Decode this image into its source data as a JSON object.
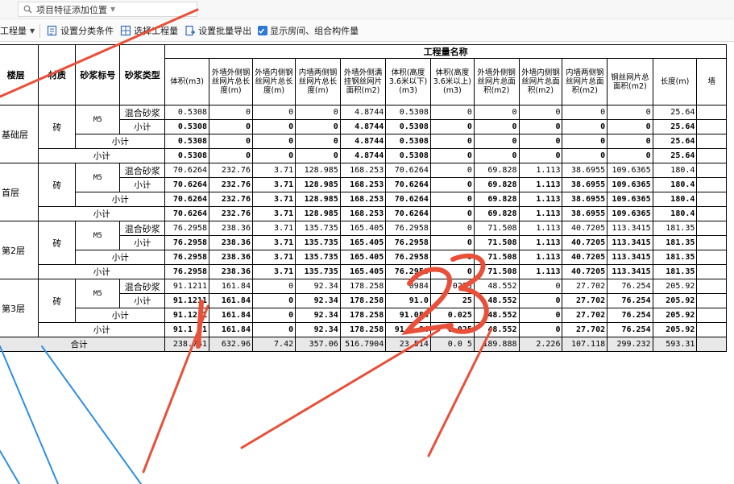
{
  "search": {
    "value": "项目特征添加位置"
  },
  "toolbar": {
    "quantity_select": "工程量",
    "set_classification": "设置分类条件",
    "select_quantity": "选择工程量",
    "batch_export": "设置批量导出",
    "show_rooms_label": "显示房间、组合构件量",
    "show_rooms_checked": true
  },
  "table": {
    "group_header": "工程量名称",
    "headers": {
      "floor": "楼层",
      "material": "材质",
      "mortar_grade": "砂浆标号",
      "mortar_type": "砂浆类型"
    },
    "columns": [
      "体积(m3)",
      "外墙外侧钢丝网片总长度(m)",
      "外墙内侧钢丝网片总长度(m)",
      "内墙两侧钢丝网片总长度(m)",
      "外墙外侧满挂钢丝网片面积(m2)",
      "体积(高度3.6米以下)(m3)",
      "体积(高度3.6米以上)(m3)",
      "外墙外侧钢丝网片总面积(m2)",
      "外墙内侧钢丝网片总面积(m2)",
      "内墙两侧钢丝网片总面积(m2)",
      "钢丝网片总面积(m2)",
      "长度(m)",
      "墙"
    ],
    "labels": {
      "subtotal": "小计",
      "total": "合计"
    },
    "floors": [
      {
        "name": "基础层",
        "material": "砖",
        "grade": "M5",
        "mortar": "混合砂浆",
        "row": [
          "0.5308",
          "0",
          "0",
          "0",
          "4.8744",
          "0.5308",
          "0",
          "0",
          "0",
          "0",
          "0",
          "25.64"
        ],
        "sub1": [
          "0.5308",
          "0",
          "0",
          "0",
          "4.8744",
          "0.5308",
          "0",
          "0",
          "0",
          "0",
          "0",
          "25.64"
        ],
        "sub2": [
          "0.5308",
          "0",
          "0",
          "0",
          "4.8744",
          "0.5308",
          "0",
          "0",
          "0",
          "0",
          "0",
          "25.64"
        ],
        "sub3": [
          "0.5308",
          "0",
          "0",
          "0",
          "4.8744",
          "0.5308",
          "0",
          "0",
          "0",
          "0",
          "0",
          "25.64"
        ]
      },
      {
        "name": "首层",
        "material": "砖",
        "grade": "M5",
        "mortar": "混合砂浆",
        "row": [
          "70.6264",
          "232.76",
          "3.71",
          "128.985",
          "168.253",
          "70.6264",
          "0",
          "69.828",
          "1.113",
          "38.6955",
          "109.6365",
          "180.4"
        ],
        "sub1": [
          "70.6264",
          "232.76",
          "3.71",
          "128.985",
          "168.253",
          "70.6264",
          "0",
          "69.828",
          "1.113",
          "38.6955",
          "109.6365",
          "180.4"
        ],
        "sub2": [
          "70.6264",
          "232.76",
          "3.71",
          "128.985",
          "168.253",
          "70.6264",
          "0",
          "69.828",
          "1.113",
          "38.6955",
          "109.6365",
          "180.4"
        ],
        "sub3": [
          "70.6264",
          "232.76",
          "3.71",
          "128.985",
          "168.253",
          "70.6264",
          "0",
          "69.828",
          "1.113",
          "38.6955",
          "109.6365",
          "180.4"
        ]
      },
      {
        "name": "第2层",
        "material": "砖",
        "grade": "M5",
        "mortar": "混合砂浆",
        "row": [
          "76.2958",
          "238.36",
          "3.71",
          "135.735",
          "165.405",
          "76.2958",
          "0",
          "71.508",
          "1.113",
          "40.7205",
          "113.3415",
          "181.35"
        ],
        "sub1": [
          "76.2958",
          "238.36",
          "3.71",
          "135.735",
          "165.405",
          "76.2958",
          "0",
          "71.508",
          "1.113",
          "40.7205",
          "113.3415",
          "181.35"
        ],
        "sub2": [
          "76.2958",
          "238.36",
          "3.71",
          "135.735",
          "165.405",
          "76.2958",
          "0",
          "71.508",
          "1.113",
          "40.7205",
          "113.3415",
          "181.35"
        ],
        "sub3": [
          "76.2958",
          "238.36",
          "3.71",
          "135.735",
          "165.405",
          "76.2958",
          "0",
          "71.508",
          "1.113",
          "40.7205",
          "113.3415",
          "181.35"
        ]
      },
      {
        "name": "第3层",
        "material": "砖",
        "grade": "M5",
        "mortar": "混合砂浆",
        "row": [
          "91.1211",
          "161.84",
          "0",
          "92.34",
          "178.258",
          "0984",
          "0225",
          "48.552",
          "0",
          "27.702",
          "76.254",
          "205.92"
        ],
        "sub1": [
          "91.1211",
          "161.84",
          "0",
          "92.34",
          "178.258",
          "91.0",
          "25",
          "48.552",
          "0",
          "27.702",
          "76.254",
          "205.92"
        ],
        "sub2": [
          "91.1211",
          "161.84",
          "0",
          "92.34",
          "178.258",
          "91.084",
          "0.025",
          "48.552",
          "0",
          "27.702",
          "76.254",
          "205.92"
        ],
        "sub3": [
          "91.1 11",
          "161.84",
          "0",
          "92.34",
          "178.258",
          "91.0 84",
          "0.025",
          "48.552",
          "0",
          "27.702",
          "76.254",
          "205.92"
        ]
      }
    ],
    "total_row": [
      "238.741",
      "632.96",
      "7.42",
      "357.06",
      "516.7904",
      "23 514",
      "0.0 5",
      "189.888",
      "2.226",
      "107.118",
      "299.232",
      "593.31"
    ]
  },
  "annotations": {
    "handwritten": "23",
    "stroke_color": "#e8503a",
    "line_color": "#2f8fe0"
  }
}
